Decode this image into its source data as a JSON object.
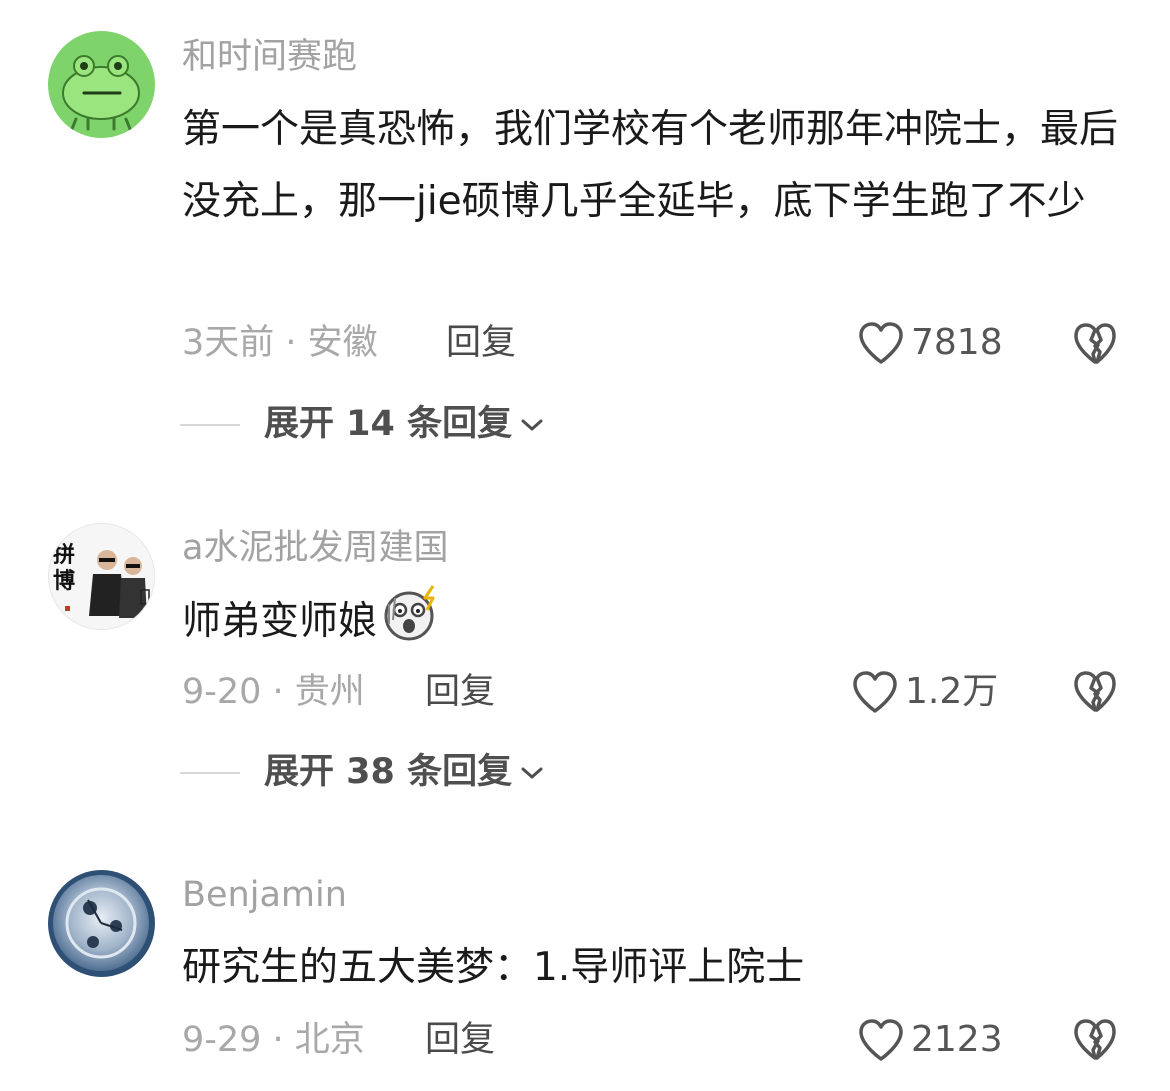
{
  "comments": [
    {
      "username": "和时间赛跑",
      "text": "第一个是真恐怖，我们学校有个老师那年冲院士，最后没充上，那一jie硕博几乎全延毕，底下学生跑了不少",
      "meta": "3天前 · 安徽",
      "reply_label": "回复",
      "likes": "7818",
      "expand_label": "展开 14 条回复",
      "avatar_icon": "frog-avatar-icon"
    },
    {
      "username": "a水泥批发周建国",
      "text": "师弟变师娘",
      "emoji": "shocked-face-emoji",
      "meta": "9-20 · 贵州",
      "reply_label": "回复",
      "likes": "1.2万",
      "expand_label": "展开 38 条回复",
      "avatar_icon": "two-men-avatar-icon",
      "avatar_text": "拼博"
    },
    {
      "username": "Benjamin",
      "text": "研究生的五大美梦：1.导师评上院士",
      "meta": "9-29 · 北京",
      "reply_label": "回复",
      "likes": "2123",
      "avatar_icon": "watch-avatar-icon"
    }
  ],
  "colors": {
    "username": "#a2a2a2",
    "body_text": "#1a1a1a",
    "meta": "#a8a8a8",
    "action": "#4a4a4a",
    "frog_green": "#7ed36a"
  }
}
